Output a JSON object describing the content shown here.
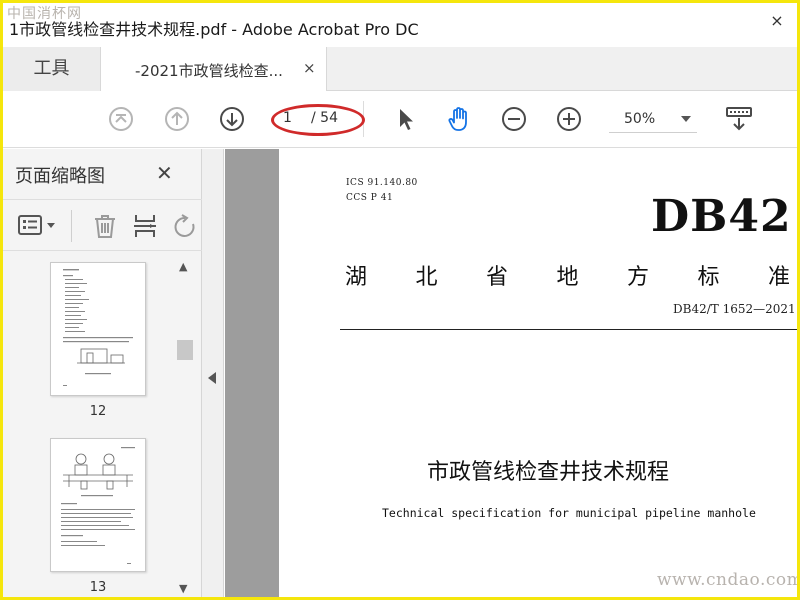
{
  "watermark": {
    "top": "中国消杯网",
    "bottom": "www.cndao.com"
  },
  "window": {
    "title": "1市政管线检查井技术规程.pdf - Adobe Acrobat Pro DC",
    "close_glyph": "×"
  },
  "tabs": {
    "tools_label": "工具",
    "doc_label": "-2021市政管线检查...",
    "doc_close_glyph": "×"
  },
  "toolbar": {
    "page_current": "1",
    "page_total": "/ 54",
    "zoom_value": "50%"
  },
  "left_panel": {
    "title": "页面缩略图",
    "close_glyph": "✕",
    "thumbnails": [
      {
        "page_label": "12"
      },
      {
        "page_label": "13"
      }
    ]
  },
  "document": {
    "ics": "ICS  91.140.80",
    "ccs": "CCS  P 41",
    "standard_code": "DB42",
    "province_chars": [
      "湖",
      "北",
      "省",
      "地",
      "方",
      "标",
      "准"
    ],
    "standard_number": "DB42/T 1652—2021",
    "title": "市政管线检查井技术规程",
    "subtitle": "Technical specification for municipal pipeline manhole"
  },
  "colors": {
    "highlight_ellipse": "#d02a2a",
    "frame_border": "#f5e60c",
    "hand_tool_active": "#1473e6"
  }
}
